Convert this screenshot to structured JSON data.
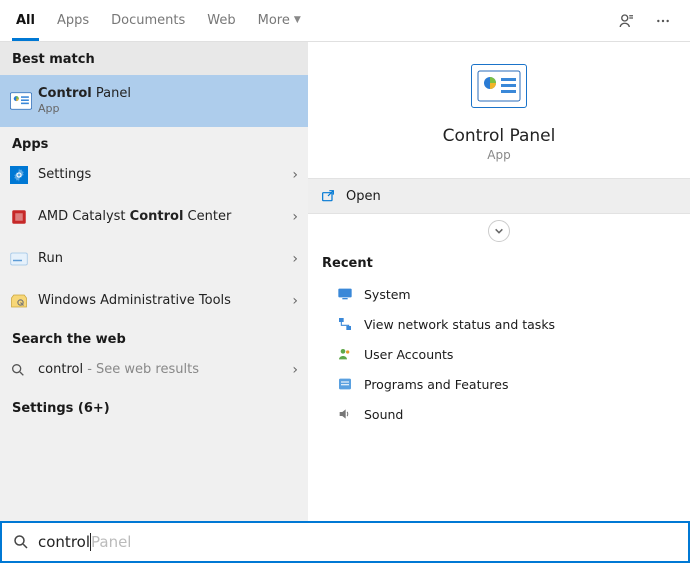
{
  "tabs": {
    "items": [
      {
        "label": "All",
        "active": true
      },
      {
        "label": "Apps",
        "active": false
      },
      {
        "label": "Documents",
        "active": false
      },
      {
        "label": "Web",
        "active": false
      },
      {
        "label": "More",
        "active": false,
        "dropdown": true
      }
    ]
  },
  "left": {
    "best_match_header": "Best match",
    "best_match": {
      "title_pre": "Control",
      "title_post": " Panel",
      "sub": "App"
    },
    "apps_header": "Apps",
    "apps": [
      {
        "label": "Settings",
        "icon": "settings"
      },
      {
        "label_pre": "AMD Catalyst ",
        "label_bold": "Control",
        "label_post": " Center",
        "icon": "amd"
      },
      {
        "label": "Run",
        "icon": "run"
      },
      {
        "label": "Windows Administrative Tools",
        "icon": "admin"
      }
    ],
    "search_web_header": "Search the web",
    "search_web": {
      "term": "control",
      "suffix": " - See web results"
    },
    "settings_more": "Settings (6+)"
  },
  "preview": {
    "title": "Control Panel",
    "sub": "App",
    "open_label": "Open",
    "recent_header": "Recent",
    "recent": [
      {
        "label": "System",
        "icon": "system"
      },
      {
        "label": "View network status and tasks",
        "icon": "network"
      },
      {
        "label": "User Accounts",
        "icon": "users"
      },
      {
        "label": "Programs and Features",
        "icon": "programs"
      },
      {
        "label": "Sound",
        "icon": "sound"
      }
    ]
  },
  "search": {
    "typed": "control",
    "ghost": " Panel"
  }
}
